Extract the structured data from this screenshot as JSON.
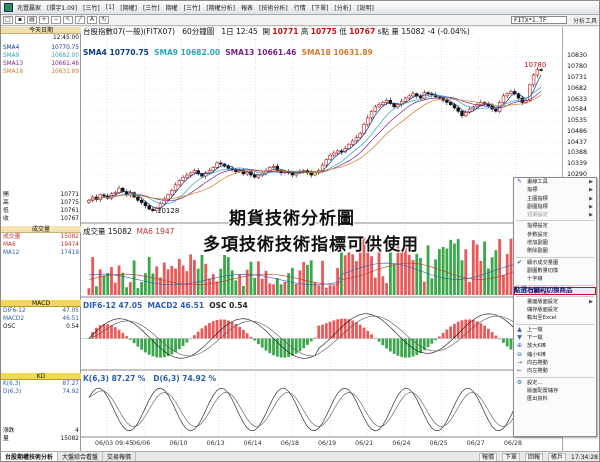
{
  "app": {
    "title_menu": [
      "兆豐贏家",
      "[環宇1.09]",
      "[三竹]",
      "[1]",
      "[期權]",
      "[三竹]",
      "期權",
      "[三竹]",
      "[期權分析]",
      "報表",
      "[技術分析]",
      "行情",
      "[下單]",
      "[分析]",
      "[說明]"
    ],
    "symbol_input": "FITX*1.TF",
    "toolbar_label": "分析工具"
  },
  "left_panel": {
    "header_date": "今天日期",
    "header_time": "12:45:00",
    "sma_rows": [
      {
        "label": "SMA4",
        "value": "10770.75",
        "color": "#0a3a8a"
      },
      {
        "label": "SMA9",
        "value": "10682.00",
        "color": "#2aa7b4"
      },
      {
        "label": "SMA13",
        "value": "10661.46",
        "color": "#7a1f8a"
      },
      {
        "label": "SMA18",
        "value": "10631.89",
        "color": "#d07a2a"
      }
    ],
    "ohlc_rows": [
      {
        "label": "開",
        "value": "10771"
      },
      {
        "label": "高",
        "value": "10775"
      },
      {
        "label": "低",
        "value": "10761"
      },
      {
        "label": "收",
        "value": "10767"
      }
    ],
    "vol_header": "成交量",
    "vol_rows": [
      {
        "label": "成交量",
        "value": "15082",
        "color": "#c23434"
      },
      {
        "label": "MA6",
        "value": "19474",
        "color": "#c23434"
      },
      {
        "label": "MA12",
        "value": "17419",
        "color": "#2a5db0"
      }
    ],
    "macd_header": "MACD",
    "macd_rows": [
      {
        "label": "DIF6-12",
        "value": "47.05",
        "color": "#2a5db0"
      },
      {
        "label": "MACD2",
        "value": "46.51",
        "color": "#2a5db0"
      },
      {
        "label": "OSC",
        "value": "0.54",
        "color": "#222"
      }
    ],
    "kd_header": "KD",
    "kd_rows": [
      {
        "label": "K(6,3)",
        "value": "87.27",
        "color": "#2a5db0"
      },
      {
        "label": "D(6,3)",
        "value": "74.92",
        "color": "#2a5db0"
      }
    ],
    "footer_rows": [
      {
        "label": "漲跌",
        "value": "4"
      },
      {
        "label": "量",
        "value": "15082"
      }
    ]
  },
  "chart_header": {
    "instrument": "台股指數07(一般)(FITX07)",
    "interval": "60分鐘圖",
    "day": "1日",
    "time": "12:45",
    "open_label": "開",
    "open": "10771",
    "high_label": "高",
    "high": "10775",
    "low_label": "低",
    "low": "10767",
    "last_label": "s點",
    "vol_label": "量",
    "volume": "15082",
    "change": "-4",
    "change_pct": "(-0.04%)"
  },
  "ma_legend": [
    {
      "label": "SMA4",
      "value": "10770.75",
      "color": "#0a3a8a"
    },
    {
      "label": "SMA9",
      "value": "10682.00",
      "color": "#2aa7b4"
    },
    {
      "label": "SMA13",
      "value": "10661.46",
      "color": "#7a1f8a"
    },
    {
      "label": "SMA18",
      "value": "10631.89",
      "color": "#d07a2a"
    }
  ],
  "vol_legend": {
    "text": "成交量 15082",
    "ma6": "MA6 1947"
  },
  "macd_legend": {
    "dif": "DIF6-12 47.05",
    "macd": "MACD2 46.51",
    "osc": "OSC 0.54"
  },
  "kd_legend": {
    "k": "K(6,3) 87.27 %",
    "d": "D(6,3) 74.92 %"
  },
  "annotations": {
    "high": "10780",
    "low": "10128"
  },
  "overlay_text": [
    "期貨技術分析圖",
    "多項技術技術指標可供使用"
  ],
  "hint_text": "點選右鍵可切換商品",
  "chart_data": [
    {
      "type": "candlestick",
      "title": "台股指數07(一般)(FITX07) 60分鐘圖",
      "x_ticks": [
        "06/03 09:45",
        "06/06",
        "06/10",
        "06/13",
        "06/14",
        "06/18",
        "06/19",
        "06/21",
        "06/24",
        "06/25",
        "06/27",
        "06/28"
      ],
      "y_ticks": [
        10830,
        10780,
        10731,
        10682,
        10633,
        10584,
        10535,
        10486,
        10437,
        10388,
        10339,
        10290
      ],
      "ylim": [
        10090,
        10845
      ],
      "close_path": [
        10175,
        10190,
        10178,
        10200,
        10195,
        10185,
        10205,
        10210,
        10230,
        10215,
        10200,
        10210,
        10190,
        10175,
        10165,
        10150,
        10135,
        10128,
        10140,
        10160,
        10180,
        10200,
        10220,
        10245,
        10265,
        10280,
        10290,
        10300,
        10310,
        10295,
        10285,
        10300,
        10310,
        10325,
        10345,
        10340,
        10330,
        10320,
        10315,
        10305,
        10310,
        10295,
        10305,
        10290,
        10280,
        10290,
        10300,
        10310,
        10325,
        10330,
        10310,
        10300,
        10305,
        10300,
        10290,
        10300,
        10305,
        10310,
        10300,
        10290,
        10300,
        10310,
        10335,
        10360,
        10380,
        10390,
        10400,
        10395,
        10410,
        10430,
        10445,
        10460,
        10480,
        10520,
        10550,
        10580,
        10600,
        10610,
        10620,
        10630,
        10615,
        10600,
        10610,
        10625,
        10640,
        10650,
        10660,
        10650,
        10640,
        10665,
        10660,
        10655,
        10645,
        10640,
        10630,
        10620,
        10610,
        10595,
        10580,
        10560,
        10575,
        10590,
        10600,
        10610,
        10620,
        10615,
        10605,
        10590,
        10580,
        10620,
        10650,
        10660,
        10670,
        10660,
        10640,
        10620,
        10630,
        10700,
        10745,
        10770,
        10767
      ],
      "series": [
        {
          "name": "SMA4",
          "value_last": 10770.75
        },
        {
          "name": "SMA9",
          "value_last": 10682.0
        },
        {
          "name": "SMA13",
          "value_last": 10661.46
        },
        {
          "name": "SMA18",
          "value_last": 10631.89
        }
      ]
    },
    {
      "type": "bar",
      "title": "成交量",
      "series": [
        {
          "name": "成交量",
          "value_last": 15082
        },
        {
          "name": "MA6",
          "value_last": 19474
        },
        {
          "name": "MA12",
          "value_last": 17419
        }
      ]
    },
    {
      "type": "bar",
      "title": "MACD",
      "series": [
        {
          "name": "DIF6-12",
          "value_last": 47.05
        },
        {
          "name": "MACD2",
          "value_last": 46.51
        },
        {
          "name": "OSC",
          "value_last": 0.54
        }
      ]
    },
    {
      "type": "line",
      "title": "KD",
      "series": [
        {
          "name": "K(6,3)",
          "value_last": 87.27
        },
        {
          "name": "D(6,3)",
          "value_last": 74.92
        }
      ]
    }
  ],
  "context_menu": {
    "items": [
      {
        "label": "畫線工具",
        "icon": "pencil-icon",
        "sub": true
      },
      {
        "label": "指標",
        "icon": "none",
        "sub": true
      },
      {
        "label": "主圖指標",
        "icon": "none",
        "sub": true
      },
      {
        "label": "副圖指標",
        "icon": "none",
        "sub": true
      },
      {
        "label": "週期設定",
        "icon": "none",
        "sub": true,
        "disabled": true
      },
      {
        "sep": true
      },
      {
        "label": "指標設定",
        "icon": "none"
      },
      {
        "label": "參數設定",
        "icon": "none"
      },
      {
        "label": "增加副圖",
        "icon": "none"
      },
      {
        "label": "刪除副圖",
        "icon": "none"
      },
      {
        "sep": true
      },
      {
        "label": "顯示成交量圖",
        "icon": "check-icon"
      },
      {
        "label": "副圖數量切換",
        "icon": "none"
      },
      {
        "label": "十字線",
        "icon": "none"
      },
      {
        "sep": true
      },
      {
        "label": "切換商品",
        "icon": "none",
        "highlight": true
      },
      {
        "sep": true
      },
      {
        "label": "畫面版面設定",
        "icon": "none",
        "sub": true
      },
      {
        "label": "儲存版面設定",
        "icon": "none"
      },
      {
        "label": "輸出至Excel",
        "icon": "none"
      },
      {
        "sep": true
      },
      {
        "label": "上一檔",
        "icon": "arrow-up-icon"
      },
      {
        "label": "下一檔",
        "icon": "arrow-down-icon"
      },
      {
        "label": "放大K棒",
        "icon": "zoom-in-icon"
      },
      {
        "label": "縮小K棒",
        "icon": "zoom-out-icon"
      },
      {
        "label": "向右捲動",
        "icon": "scroll-right-icon"
      },
      {
        "label": "向左捲動",
        "icon": "scroll-left-icon"
      },
      {
        "sep": true
      },
      {
        "label": "設定...",
        "icon": "gear-icon"
      },
      {
        "label": "版面配置儲存",
        "icon": "none"
      },
      {
        "label": "匯出資料",
        "icon": "none"
      }
    ]
  },
  "status_bar": {
    "tabs": [
      "台股期權技術分析",
      "大盤綜合看盤",
      "交易報價"
    ],
    "right": [
      "報價",
      "下單",
      "回報",
      "帳戶",
      "17:34:28"
    ]
  }
}
